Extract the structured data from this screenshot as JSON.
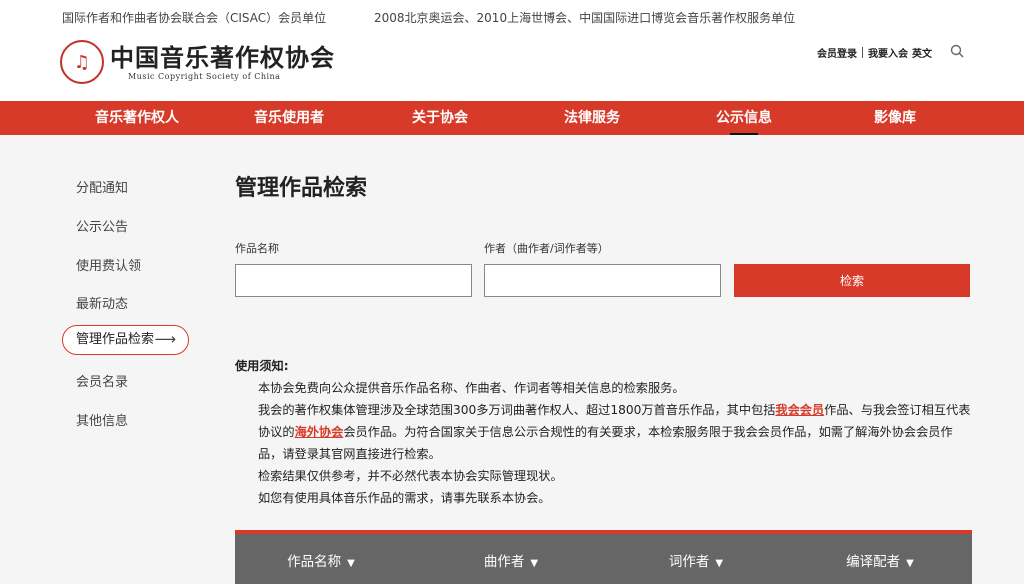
{
  "topbar": {
    "text_left": "国际作者和作曲者协会联合会（CISAC）会员单位",
    "text_right": "2008北京奥运会、2010上海世博会、中国国际进口博览会音乐著作权服务单位"
  },
  "header": {
    "logo_cn": "中国音乐著作权协会",
    "logo_en": "Music Copyright Society of China",
    "login": "会员登录",
    "join": "我要入会",
    "lang": "英文"
  },
  "nav": [
    {
      "label": "音乐著作权人"
    },
    {
      "label": "音乐使用者"
    },
    {
      "label": "关于协会"
    },
    {
      "label": "法律服务"
    },
    {
      "label": "公示信息",
      "active": true
    },
    {
      "label": "影像库"
    }
  ],
  "sidebar": {
    "items": [
      {
        "label": "分配通知"
      },
      {
        "label": "公示公告"
      },
      {
        "label": "使用费认领"
      },
      {
        "label": "最新动态"
      },
      {
        "label": "管理作品检索",
        "active": true
      },
      {
        "label": "会员名录"
      },
      {
        "label": "其他信息"
      }
    ]
  },
  "main": {
    "title": "管理作品检索",
    "work_label": "作品名称",
    "work_value": "",
    "author_label": "作者（曲作者/词作者等）",
    "author_value": "",
    "search_button": "检索"
  },
  "notice": {
    "title": "使用须知:",
    "p1": "本协会免费向公众提供音乐作品名称、作曲者、作词者等相关信息的检索服务。",
    "p2_a": "我会的著作权集体管理涉及全球范围300多万词曲著作权人、超过1800万首音乐作品，其中包括",
    "p2_link1": "我会会员",
    "p2_b": "作品、与我会签订相互代表协议的",
    "p2_link2": "海外协会",
    "p2_c": "会员作品。为符合国家关于信息公示合规性的有关要求，本检索服务限于我会会员作品，如需了解海外协会会员作品，请登录其官网直接进行检索。",
    "p3": "检索结果仅供参考，并不必然代表本协会实际管理现状。",
    "p4": "如您有使用具体音乐作品的需求，请事先联系本协会。"
  },
  "table": {
    "headers": [
      "作品名称",
      "曲作者",
      "词作者",
      "编译配者"
    ],
    "sort_icon": "▼"
  },
  "colors": {
    "accent": "#d83a2a",
    "table_header": "#666666"
  }
}
